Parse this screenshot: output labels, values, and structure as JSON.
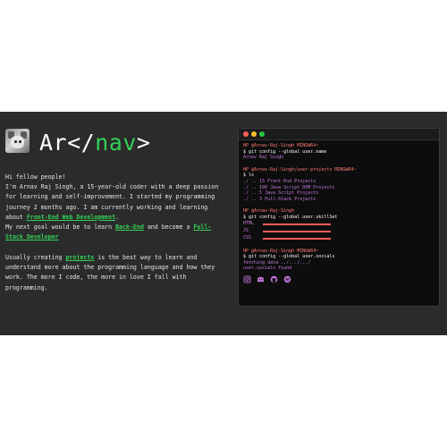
{
  "header": {
    "logo_left": "Ar</",
    "logo_mid": "nav",
    "logo_right": ">"
  },
  "intro": {
    "greeting": "Hi fellow people!",
    "line2_pre": "I'm Arnav Raj Singh, a 15-year-old coder with a deep passion for learning and self-improvement. I started my programming journey 2 months ago. I am currently working and learning about ",
    "link_frontend": "Front-End Web Development",
    "line2_post": ".",
    "goal_pre": "My next goal would be to learn ",
    "link_backend": "Back-End",
    "goal_mid": " and become a ",
    "link_fullstack": "Full-Stack Developer",
    "para2_pre": "Usually creating ",
    "link_projects": "projects",
    "para2_post": " is the best way to learn and understand more about the programming language and how they work. The more I code, the more in love I fall with programming."
  },
  "terminal": {
    "prompt1": "HP @Arnav-Raj-Singh MINGW64~",
    "cmd1": "$ git config --global user.name",
    "out1": "Arnav Raj Singh",
    "prompt2": "HP @Arnav-Raj-Singh/user-projects MINGW64~",
    "cmd2": "$ ls",
    "ls": [
      "./ .. 15 Front-End Projects",
      "./ .. 100 Java Script DOM Projects",
      "./ .. 5 Java Script Projects",
      "./ .. 3 Full-Stack Projects"
    ],
    "prompt3": "HP @Arnav-Raj-Singh",
    "cmd3": "$ git config --global user.skillSet",
    "skills": [
      {
        "label": "HTML",
        "level": 1.0
      },
      {
        "label": "JS",
        "level": 1.0
      },
      {
        "label": "CSS",
        "level": 1.0
      }
    ],
    "prompt4": "HP @Arnav-Raj-Singh MINGW64~",
    "cmd4": "$ git config --global user.socials",
    "out4a": "fetching data ../.../.../",
    "out4b": "user.socials found",
    "social_icons": [
      "instagram-icon",
      "discord-icon",
      "github-icon",
      "spotify-icon"
    ],
    "accent": "#ff5b5b"
  },
  "colors": {
    "green": "#34d058",
    "purple": "#c678dd",
    "prompt": "#ff7b72"
  }
}
